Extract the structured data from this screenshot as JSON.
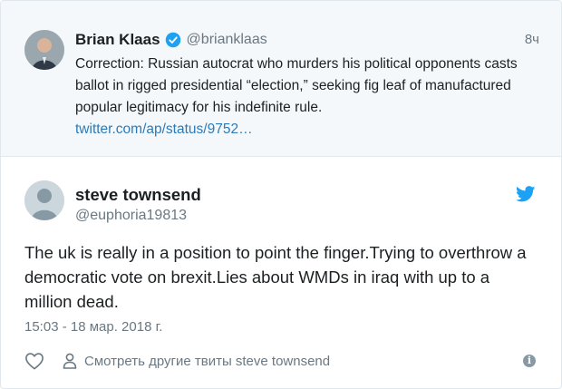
{
  "quoted": {
    "author_name": "Brian Klaas",
    "handle": "@brianklaas",
    "time": "8ч",
    "text": "Correction: Russian autocrat who murders his political opponents casts ballot in rigged presidential “election,” seeking fig leaf of manufactured popular legitimacy for his indefinite rule.",
    "link": "twitter.com/ap/status/9752…"
  },
  "tweet": {
    "author_name": "steve townsend",
    "handle": "@euphoria19813",
    "text": "The uk is really in a position to point the finger.Trying to overthrow a democratic vote on brexit.Lies about WMDs in iraq with up to a million dead.",
    "date": "15:03 - 18 мар. 2018 г.",
    "more_tweets_label": "Смотреть другие твиты steve townsend"
  },
  "icons": {
    "verified": "verified-badge-icon",
    "bird": "twitter-bird-icon",
    "like": "heart-icon",
    "profile": "person-icon",
    "info": "info-icon"
  },
  "colors": {
    "accent": "#1da1f2",
    "link": "#2b7bb9",
    "muted": "#697882",
    "quoted_bg": "#f5f8fa"
  }
}
